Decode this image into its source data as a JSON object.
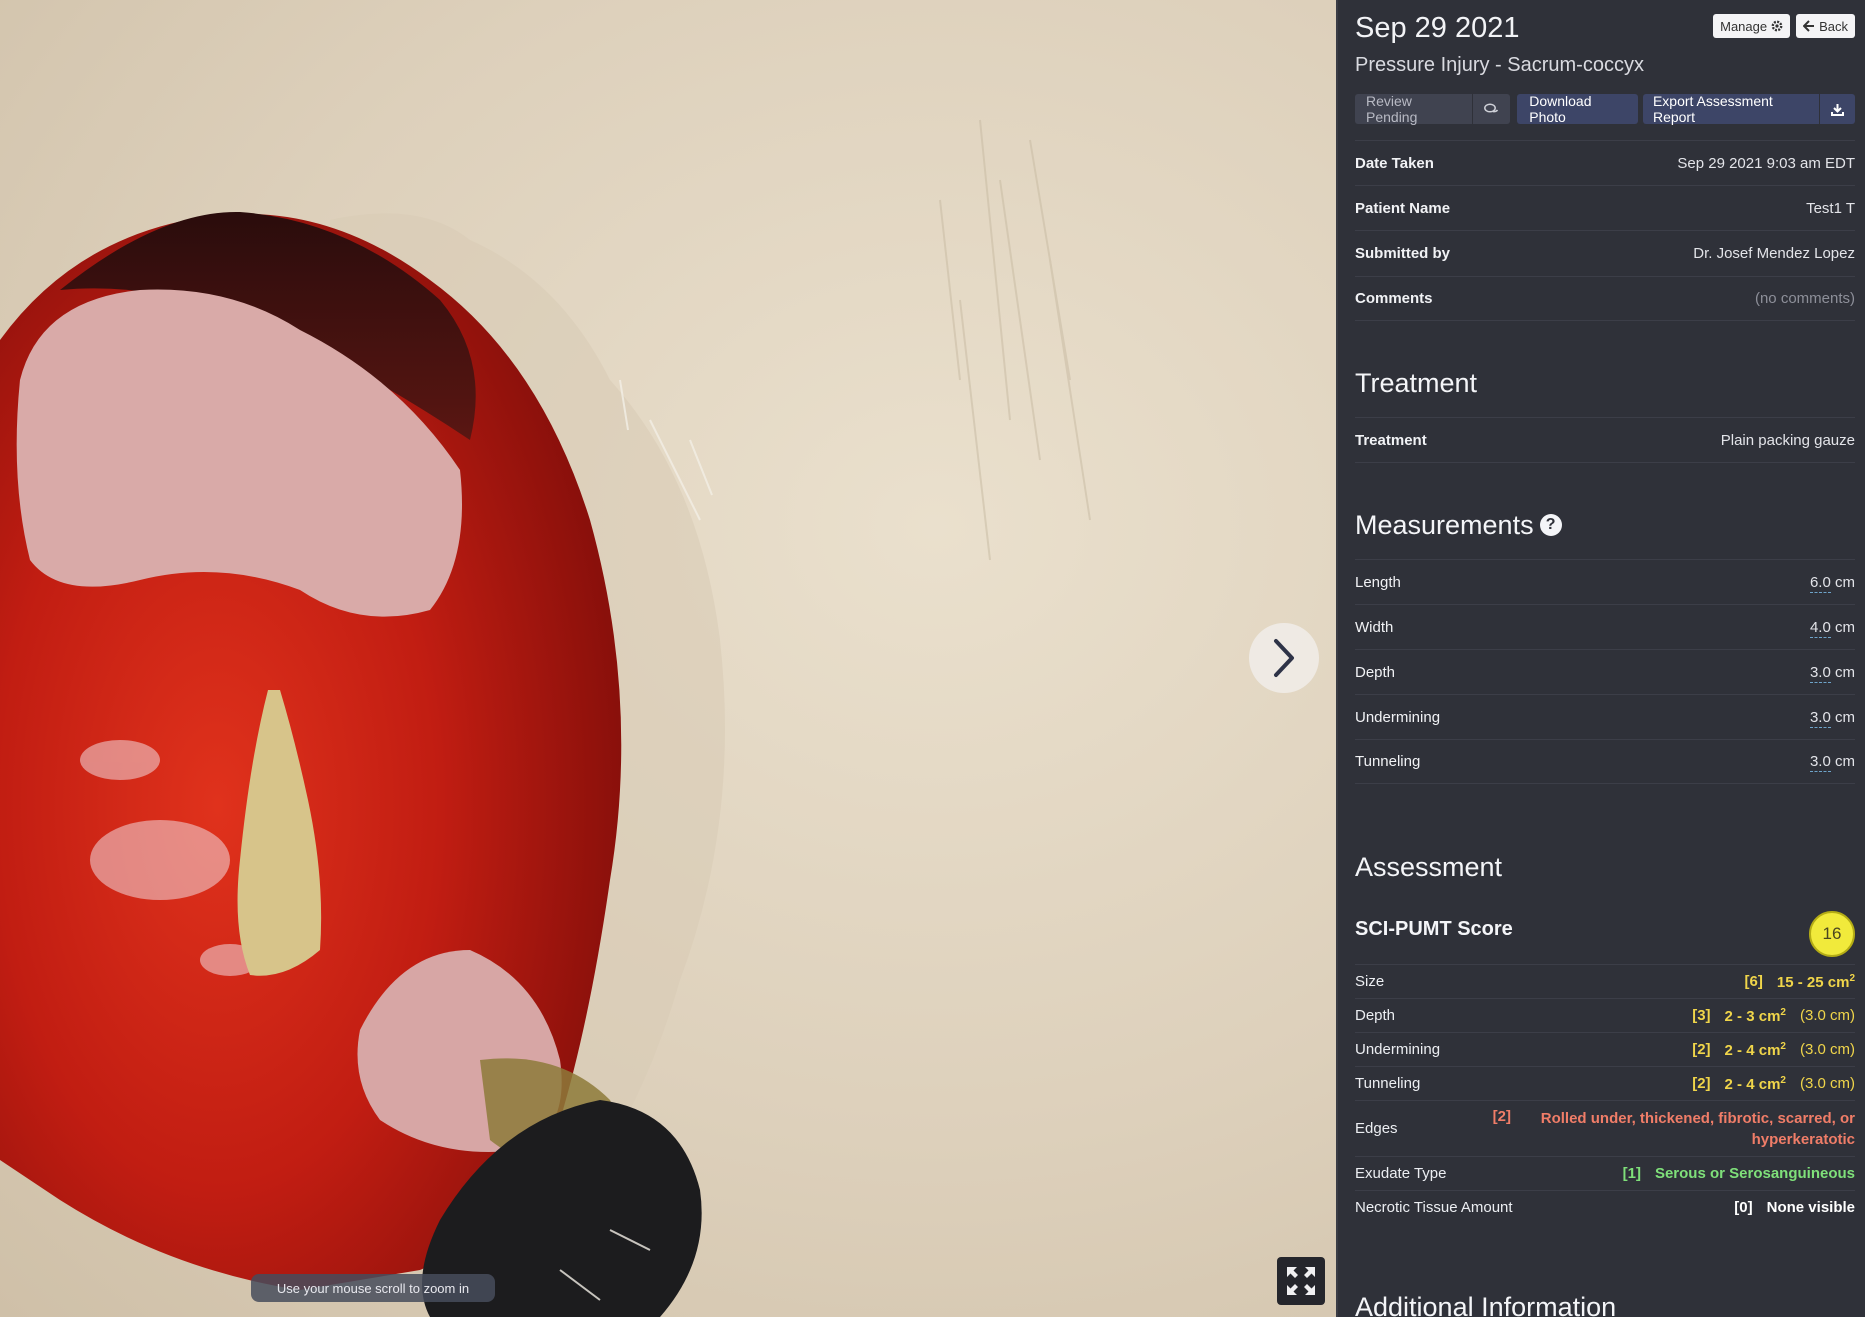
{
  "viewer": {
    "zoom_hint": "Use your mouse scroll to zoom in"
  },
  "header": {
    "date": "Sep 29 2021",
    "subtitle": "Pressure Injury - Sacrum-coccyx",
    "manage_label": "Manage",
    "back_label": "Back"
  },
  "actions": {
    "review_label": "Review Pending",
    "download_label": "Download Photo",
    "export_label": "Export Assessment Report"
  },
  "details": [
    {
      "label": "Date Taken",
      "value": "Sep 29 2021 9:03 am EDT"
    },
    {
      "label": "Patient Name",
      "value": "Test1 T"
    },
    {
      "label": "Submitted by",
      "value": "Dr. Josef Mendez Lopez"
    },
    {
      "label": "Comments",
      "value": "(no comments)"
    }
  ],
  "treatment": {
    "heading": "Treatment",
    "label": "Treatment",
    "value": "Plain packing gauze"
  },
  "measurements": {
    "heading": "Measurements",
    "items": [
      {
        "label": "Length",
        "value": "6.0",
        "unit": "cm"
      },
      {
        "label": "Width",
        "value": "4.0",
        "unit": "cm"
      },
      {
        "label": "Depth",
        "value": "3.0",
        "unit": "cm"
      },
      {
        "label": "Undermining",
        "value": "3.0",
        "unit": "cm"
      },
      {
        "label": "Tunneling",
        "value": "3.0",
        "unit": "cm"
      }
    ]
  },
  "assessment": {
    "heading": "Assessment",
    "score_label": "SCI-PUMT Score",
    "score": "16",
    "rows": [
      {
        "label": "Size",
        "score": "[6]",
        "desc": "15 - 25 cm",
        "sup": "2",
        "extra": "",
        "color": "#f0d54a"
      },
      {
        "label": "Depth",
        "score": "[3]",
        "desc": "2 - 3 cm",
        "sup": "2",
        "extra": "(3.0 cm)",
        "color": "#f0d54a"
      },
      {
        "label": "Undermining",
        "score": "[2]",
        "desc": "2 - 4 cm",
        "sup": "2",
        "extra": "(3.0 cm)",
        "color": "#f0d54a"
      },
      {
        "label": "Tunneling",
        "score": "[2]",
        "desc": "2 - 4 cm",
        "sup": "2",
        "extra": "(3.0 cm)",
        "color": "#f0d54a"
      },
      {
        "label": "Edges",
        "score": "[2]",
        "desc": "Rolled under, thickened, fibrotic, scarred, or hyperkeratotic",
        "sup": "",
        "extra": "",
        "color": "#f07d68"
      },
      {
        "label": "Exudate Type",
        "score": "[1]",
        "desc": "Serous or Serosanguineous",
        "sup": "",
        "extra": "",
        "color": "#7fe07a"
      },
      {
        "label": "Necrotic Tissue Amount",
        "score": "[0]",
        "desc": "None visible",
        "sup": "",
        "extra": "",
        "color": "#ffffff"
      }
    ]
  },
  "additional": {
    "heading": "Additional Information"
  },
  "icons": {
    "manage": "gear-icon",
    "back": "arrow-left-icon",
    "chat": "comments-icon",
    "export": "download-icon",
    "next": "chevron-right-icon",
    "fullscreen": "fullscreen-icon",
    "help": "question-circle-icon"
  }
}
